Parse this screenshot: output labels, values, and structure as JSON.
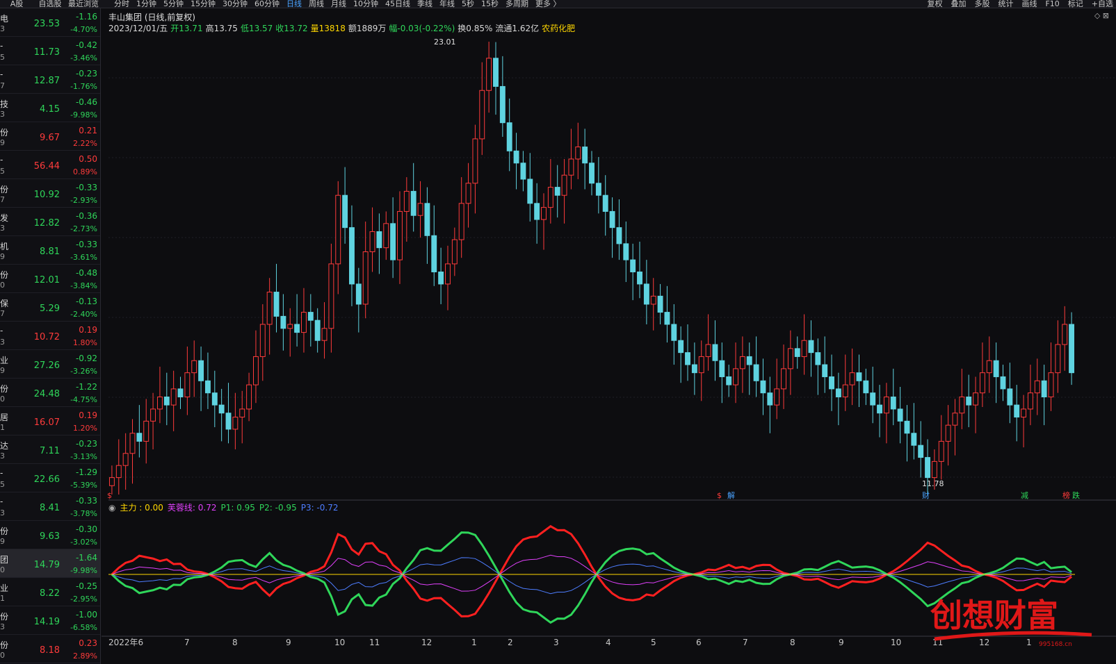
{
  "topbar": {
    "left_tabs": [
      "A股",
      "自选股",
      "最近浏览"
    ],
    "periods": [
      {
        "label": "分时",
        "active": false
      },
      {
        "label": "1分钟",
        "active": false
      },
      {
        "label": "5分钟",
        "active": false
      },
      {
        "label": "15分钟",
        "active": false
      },
      {
        "label": "30分钟",
        "active": false
      },
      {
        "label": "60分钟",
        "active": false
      },
      {
        "label": "日线",
        "active": true
      },
      {
        "label": "周线",
        "active": false
      },
      {
        "label": "月线",
        "active": false
      },
      {
        "label": "10分钟",
        "active": false
      },
      {
        "label": "45日线",
        "active": false
      },
      {
        "label": "季线",
        "active": false
      },
      {
        "label": "年线",
        "active": false
      },
      {
        "label": "5秒",
        "active": false
      },
      {
        "label": "15秒",
        "active": false
      },
      {
        "label": "多周期",
        "active": false
      },
      {
        "label": "更多 〉",
        "active": false
      }
    ],
    "right_tools": [
      "复权",
      "叠加",
      "多股",
      "统计",
      "画线",
      "F10",
      "标记",
      "+自选"
    ]
  },
  "watchlist": [
    {
      "name": "电",
      "code": "3",
      "price": "23.53",
      "chg": "-1.16",
      "pct": "-4.70%",
      "dir": "dn"
    },
    {
      "name": "-",
      "code": "5",
      "price": "11.73",
      "chg": "-0.42",
      "pct": "-3.46%",
      "dir": "dn"
    },
    {
      "name": "-",
      "code": "7",
      "price": "12.87",
      "chg": "-0.23",
      "pct": "-1.76%",
      "dir": "dn"
    },
    {
      "name": "技",
      "code": "3",
      "price": "4.15",
      "chg": "-0.46",
      "pct": "-9.98%",
      "dir": "dn"
    },
    {
      "name": "份",
      "code": "9",
      "price": "9.67",
      "chg": "0.21",
      "pct": "2.22%",
      "dir": "up"
    },
    {
      "name": "-",
      "code": "5",
      "price": "56.44",
      "chg": "0.50",
      "pct": "0.89%",
      "dir": "up"
    },
    {
      "name": "份",
      "code": "7",
      "price": "10.92",
      "chg": "-0.33",
      "pct": "-2.93%",
      "dir": "dn"
    },
    {
      "name": "发",
      "code": "3",
      "price": "12.82",
      "chg": "-0.36",
      "pct": "-2.73%",
      "dir": "dn"
    },
    {
      "name": "机",
      "code": "9",
      "price": "8.81",
      "chg": "-0.33",
      "pct": "-3.61%",
      "dir": "dn"
    },
    {
      "name": "份",
      "code": "0",
      "price": "12.01",
      "chg": "-0.48",
      "pct": "-3.84%",
      "dir": "dn"
    },
    {
      "name": "保",
      "code": "7",
      "price": "5.29",
      "chg": "-0.13",
      "pct": "-2.40%",
      "dir": "dn"
    },
    {
      "name": "-",
      "code": "3",
      "price": "10.72",
      "chg": "0.19",
      "pct": "1.80%",
      "dir": "up"
    },
    {
      "name": "业",
      "code": "9",
      "price": "27.26",
      "chg": "-0.92",
      "pct": "-3.26%",
      "dir": "dn"
    },
    {
      "name": "份",
      "code": "0",
      "price": "24.48",
      "chg": "-1.22",
      "pct": "-4.75%",
      "dir": "dn"
    },
    {
      "name": "居",
      "code": "1",
      "price": "16.07",
      "chg": "0.19",
      "pct": "1.20%",
      "dir": "up"
    },
    {
      "name": "达",
      "code": "3",
      "price": "7.11",
      "chg": "-0.23",
      "pct": "-3.13%",
      "dir": "dn"
    },
    {
      "name": "-",
      "code": "5",
      "price": "22.66",
      "chg": "-1.29",
      "pct": "-5.39%",
      "dir": "dn"
    },
    {
      "name": "-",
      "code": "3",
      "price": "8.41",
      "chg": "-0.33",
      "pct": "-3.78%",
      "dir": "dn"
    },
    {
      "name": "份",
      "code": "9",
      "price": "9.63",
      "chg": "-0.30",
      "pct": "-3.02%",
      "dir": "dn"
    },
    {
      "name": "团",
      "code": "0",
      "price": "14.79",
      "chg": "-1.64",
      "pct": "-9.98%",
      "dir": "dn",
      "selected": true
    },
    {
      "name": "业",
      "code": "1",
      "price": "8.22",
      "chg": "-0.25",
      "pct": "-2.95%",
      "dir": "dn"
    },
    {
      "name": "份",
      "code": "3",
      "price": "14.19",
      "chg": "-1.00",
      "pct": "-6.58%",
      "dir": "dn"
    },
    {
      "name": "份",
      "code": "0",
      "price": "8.18",
      "chg": "0.23",
      "pct": "2.89%",
      "dir": "up"
    }
  ],
  "chart_header": {
    "title": "丰山集团 (日线,前复权)",
    "date": "2023/12/01/五",
    "open": "开13.71",
    "high": "高13.75",
    "low": "低13.57",
    "close": "收13.72",
    "volume": "量13818",
    "amount": "额1889万",
    "range": "幅-0.03(-0.22%)",
    "turnover": "换0.85%",
    "float": "流通1.62亿",
    "sector": "农药化肥"
  },
  "indicator": {
    "main": "主力 : 0.00",
    "line": "芙蓉线: 0.72",
    "p1": "P1: 0.95",
    "p2": "P2: -0.95",
    "p3": "P3: -0.72"
  },
  "annotations": {
    "high_label": "23.01",
    "low_label": "11.78",
    "markers": [
      "$",
      "$",
      "解",
      "财",
      "减",
      "榜",
      "跌"
    ]
  },
  "x_axis_labels": [
    "2022年6",
    "7",
    "8",
    "9",
    "10",
    "11",
    "12",
    "1",
    "2",
    "3",
    "4",
    "5",
    "6",
    "7",
    "8",
    "9",
    "10",
    "11",
    "12",
    "1"
  ],
  "watermark": {
    "text": "创想财富",
    "url": "995168.cn"
  },
  "colors": {
    "up": "#ff3b3b",
    "down": "#5fd3e0",
    "green": "#2fd65a",
    "yellow": "#ffd700",
    "magenta": "#e040fb",
    "blue": "#4d7dff"
  },
  "chart_data": {
    "type": "candlestick",
    "y_range": [
      11.78,
      23.01
    ],
    "closes": [
      12.2,
      12.5,
      12.8,
      13.3,
      13.1,
      13.6,
      13.9,
      14.2,
      14.0,
      14.4,
      14.2,
      14.8,
      15.1,
      14.6,
      14.3,
      14.0,
      13.8,
      13.4,
      13.7,
      13.9,
      14.5,
      15.2,
      16.0,
      16.8,
      16.2,
      15.9,
      16.0,
      15.8,
      16.3,
      16.1,
      15.6,
      15.9,
      17.5,
      19.2,
      18.4,
      17.0,
      16.5,
      17.8,
      18.3,
      17.9,
      18.5,
      17.6,
      18.8,
      19.3,
      18.7,
      19.0,
      18.2,
      17.3,
      17.0,
      17.5,
      18.1,
      19.0,
      19.5,
      20.6,
      21.8,
      22.6,
      21.9,
      21.0,
      20.3,
      20.0,
      19.6,
      19.0,
      18.6,
      18.9,
      19.4,
      19.2,
      19.7,
      20.1,
      20.4,
      20.0,
      19.5,
      19.2,
      18.8,
      18.4,
      18.0,
      17.6,
      17.3,
      17.0,
      16.5,
      16.7,
      16.3,
      16.0,
      15.6,
      15.3,
      15.0,
      14.8,
      15.2,
      15.5,
      15.1,
      14.7,
      14.5,
      14.9,
      15.2,
      15.0,
      14.6,
      14.3,
      14.0,
      14.4,
      14.9,
      15.4,
      15.2,
      15.6,
      15.3,
      15.0,
      14.7,
      14.4,
      14.2,
      14.5,
      14.8,
      14.6,
      14.3,
      14.0,
      13.8,
      14.2,
      13.9,
      13.6,
      13.3,
      13.0,
      12.7,
      12.2,
      12.6,
      13.1,
      13.5,
      13.8,
      14.2,
      14.0,
      14.3,
      14.8,
      15.1,
      14.7,
      14.4,
      14.0,
      13.7,
      13.9,
      14.3,
      14.6,
      14.2,
      14.8,
      15.5,
      16.0,
      14.8
    ]
  }
}
